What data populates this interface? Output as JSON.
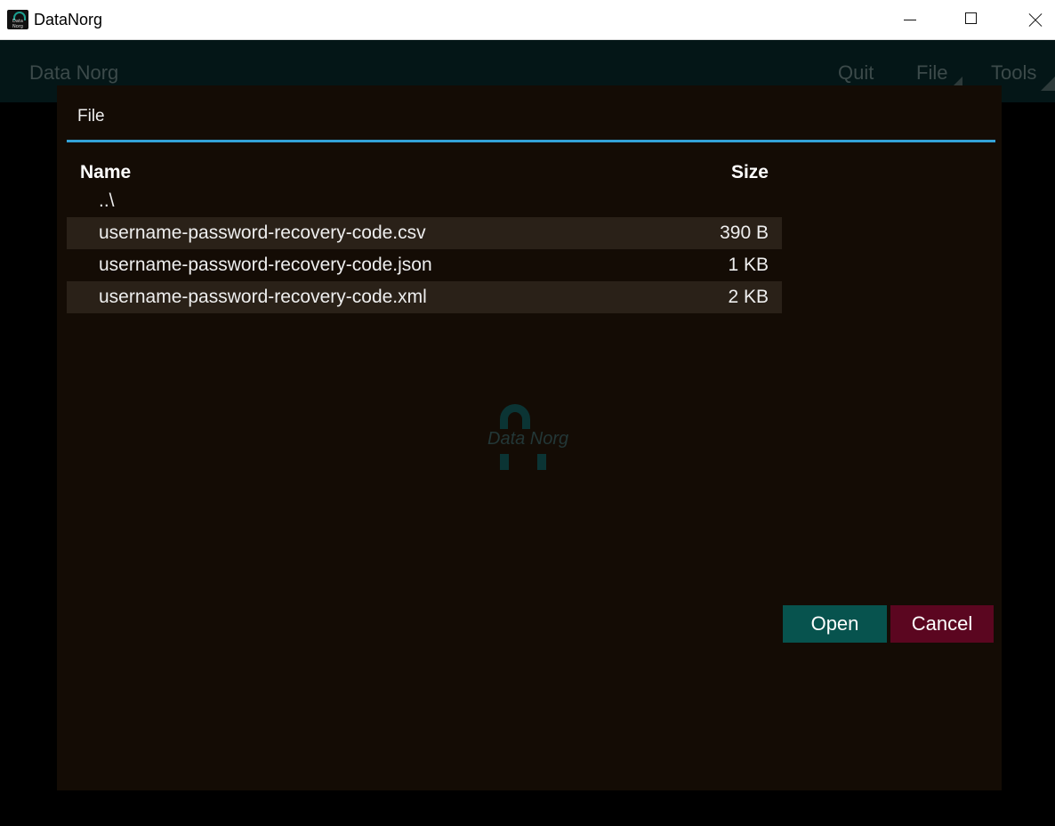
{
  "window": {
    "title": "DataNorg",
    "icon_text": "Data Norg"
  },
  "appbar": {
    "brand": "Data Norg",
    "menu": {
      "quit": "Quit",
      "file": "File",
      "tools": "Tools"
    }
  },
  "dialog": {
    "title": "File",
    "columns": {
      "name": "Name",
      "size": "Size"
    },
    "rows": [
      {
        "name": "..\\",
        "size": ""
      },
      {
        "name": "username-password-recovery-code.csv",
        "size": "390 B"
      },
      {
        "name": "username-password-recovery-code.json",
        "size": "1 KB"
      },
      {
        "name": "username-password-recovery-code.xml",
        "size": "2 KB"
      }
    ],
    "watermark": "Data Norg",
    "buttons": {
      "open": "Open",
      "cancel": "Cancel"
    }
  },
  "colors": {
    "accent_line": "#33a2d8",
    "open_button": "#07534e",
    "cancel_button": "#5b0620",
    "dialog_bg": "#140c05"
  }
}
